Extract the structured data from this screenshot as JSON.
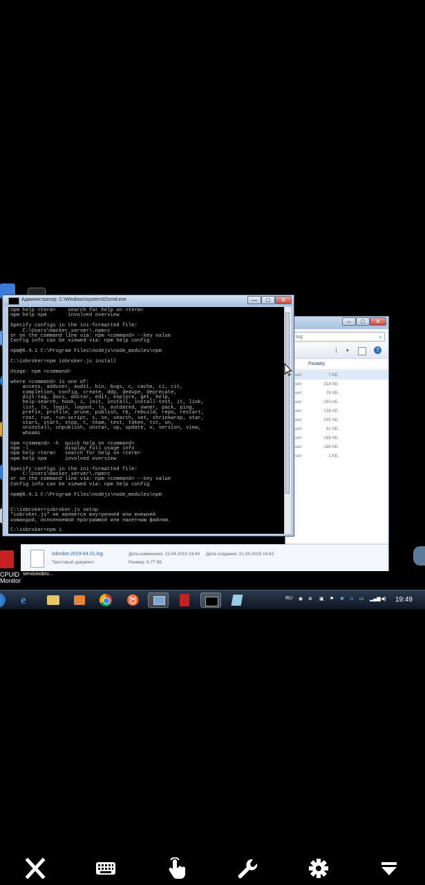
{
  "cmd": {
    "title": "Администратор: C:\\Windows\\system32\\cmd.exe",
    "lines": [
      "npm help <term>    search for help on <term>",
      "npm help npm       involved overview",
      "",
      "Specify configs in the ini-formatted file:",
      "    C:\\Users\\Hacker_server\\.npmrc",
      "or on the command line via: npm <command> --key value",
      "Config info can be viewed via: npm help config",
      "",
      "npm@6.4.1 C:\\Program Files\\nodejs\\node_modules\\npm",
      "",
      "C:\\iobroker>npm iobroker.js install",
      "",
      "Usage: npm <command>",
      "",
      "where <command> is one of:",
      "    access, adduser, audit, bin, bugs, c, cache, ci, cit,",
      "    completion, config, create, ddp, dedupe, deprecate,",
      "    dist-tag, docs, doctor, edit, explore, get, help,",
      "    help-search, hook, i, init, install, install-test, it, link,",
      "    list, ln, login, logout, ls, outdated, owner, pack, ping,",
      "    prefix, profile, prune, publish, rb, rebuild, repo, restart,",
      "    root, run, run-script, s, se, search, set, shrinkwrap, star,",
      "    stars, start, stop, t, team, test, token, tst, un,",
      "    uninstall, unpublish, unstar, up, update, v, version, view,",
      "    whoami",
      "",
      "npm <command> -h  quick help on <command>",
      "npm -l            display full usage info",
      "npm help <term>   search for help on <term>",
      "npm help npm      involved overview",
      "",
      "Specify configs in the ini-formatted file:",
      "    C:\\Users\\Hacker_server\\.npmrc",
      "or on the command line via: npm <command> --key value",
      "Config info can be viewed via: npm help config",
      "",
      "npm@6.4.1 C:\\Program Files\\nodejs\\node_modules\\npm",
      "",
      "",
      "C:\\iobroker>iobroker.js setup",
      "\"iobroker.js\" не является внутренней или внешней",
      "командой, исполняемой программой или пакетным файлом.",
      "",
      "C:\\iobroker>npm i"
    ],
    "controls": {
      "minimize": "—",
      "maximize": "□",
      "close": "✕"
    }
  },
  "explorer": {
    "address_hint": "log",
    "size_header": "Размер",
    "rows": [
      {
        "type": "ент",
        "size": "7 КБ"
      },
      {
        "type": "ент",
        "size": "318 КБ"
      },
      {
        "type": "ент",
        "size": "76 КБ"
      },
      {
        "type": "ент",
        "size": "293 КБ"
      },
      {
        "type": "ент",
        "size": "138 КБ"
      },
      {
        "type": "ент",
        "size": "245 КБ"
      },
      {
        "type": "ент",
        "size": "82 КБ"
      },
      {
        "type": "ент",
        "size": "198 КБ"
      },
      {
        "type": "ент",
        "size": "186 КБ"
      },
      {
        "type": "ент",
        "size": "1 КБ"
      }
    ],
    "details": {
      "filename": "iobroker.2019-04-21.log",
      "type": "Текстовый документ",
      "modified_label": "Дата изменения: 21.04.2019 19:44",
      "size_label": "Размер: 6,77 КБ",
      "created_label": "Дата создания: 21.04.2019 14:42"
    }
  },
  "desktop": {
    "labels": [
      "CPUID",
      "Monitor",
      "serviceiobro..."
    ]
  },
  "taskbar": {
    "lang": "RU",
    "time": "19:49"
  },
  "icons": {
    "close": "close-icon",
    "keyboard": "keyboard-icon",
    "touch": "touch-icon",
    "wrench": "wrench-icon",
    "settings": "gear-icon",
    "menu": "dropdown-icon"
  }
}
